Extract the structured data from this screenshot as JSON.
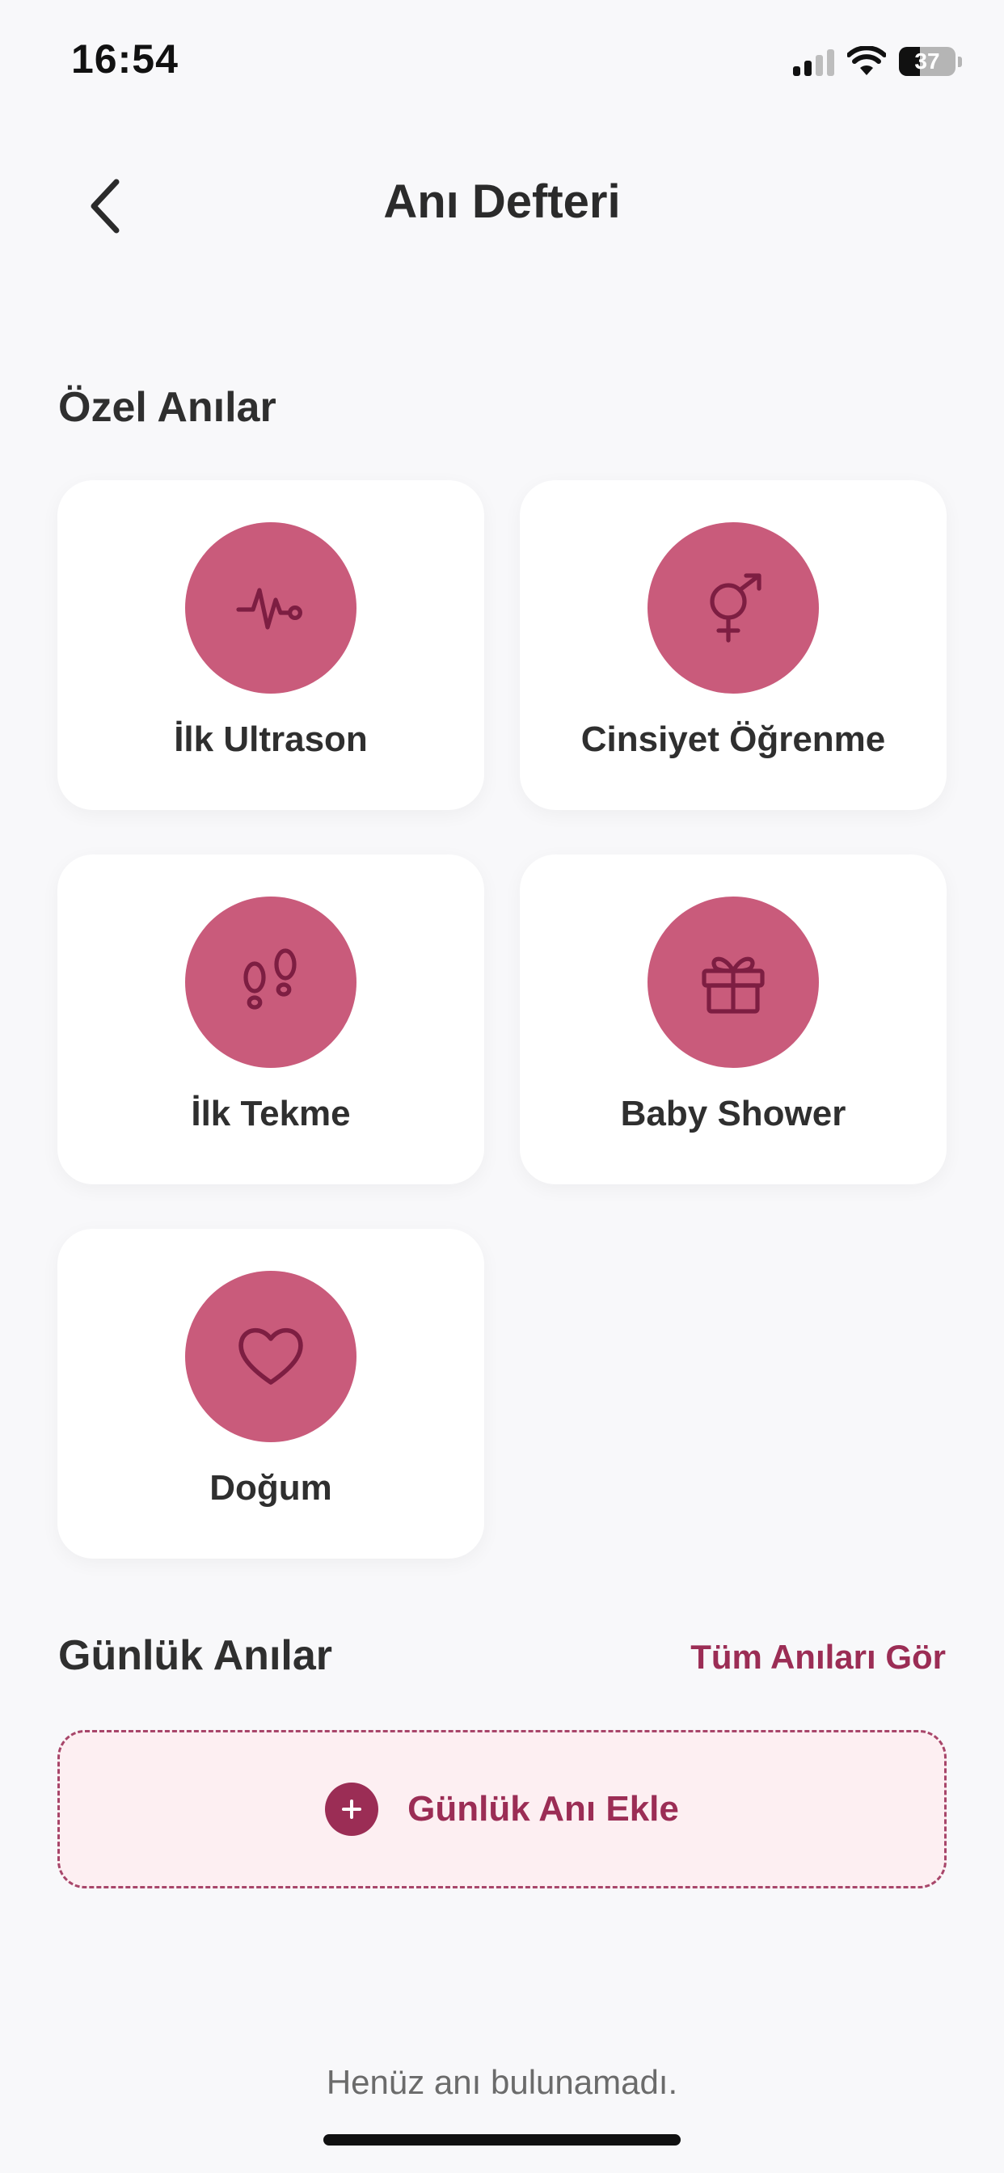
{
  "status_bar": {
    "time": "16:54",
    "battery_level": "37",
    "battery_fraction": 0.37,
    "signal_bars_active": 2,
    "signal_bars_total": 4
  },
  "header": {
    "title": "Anı Defteri",
    "back_icon": "chevron-left-icon"
  },
  "special_memories": {
    "title": "Özel Anılar",
    "items": [
      {
        "label": "İlk Ultrason",
        "icon": "heartbeat-icon"
      },
      {
        "label": "Cinsiyet Öğrenme",
        "icon": "gender-symbol-icon"
      },
      {
        "label": "İlk Tekme",
        "icon": "footprints-icon"
      },
      {
        "label": "Baby Shower",
        "icon": "gift-icon"
      },
      {
        "label": "Doğum",
        "icon": "heart-icon"
      }
    ]
  },
  "daily_memories": {
    "title": "Günlük Anılar",
    "see_all_label": "Tüm Anıları Gör",
    "add_button_label": "Günlük Anı Ekle",
    "empty_message": "Henüz anı bulunamadı."
  },
  "colors": {
    "accent": "#9b2d55",
    "icon_circle": "#c95b7b",
    "icon_stroke": "#7d1e42",
    "background": "#f8f8fa",
    "add_button_bg": "#fdeff2"
  }
}
